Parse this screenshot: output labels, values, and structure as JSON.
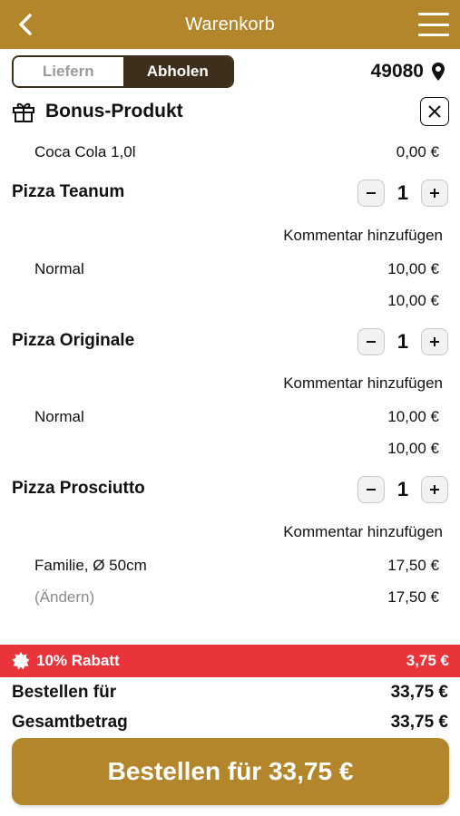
{
  "colors": {
    "accent": "#b4862c",
    "toggle_dark": "#3e2f1c",
    "discount_red": "#e8343a"
  },
  "header": {
    "title": "Warenkorb",
    "back_icon": "chevron-left-icon",
    "menu_icon": "hamburger-menu-icon"
  },
  "delivery_toggle": {
    "options": [
      "Liefern",
      "Abholen"
    ],
    "selected": "Abholen"
  },
  "location": {
    "zip": "49080",
    "icon": "map-pin-icon"
  },
  "bonus": {
    "label": "Bonus-Produkt",
    "icon": "gift-icon",
    "close_icon": "close-icon",
    "item": {
      "name": "Coca Cola 1,0l",
      "price": "0,00 €"
    }
  },
  "products": [
    {
      "name": "Pizza Teanum",
      "qty": "1",
      "comment": "Kommentar hinzufügen",
      "variant": "Normal",
      "variant_price": "10,00 €",
      "total": "10,00 €"
    },
    {
      "name": "Pizza Originale",
      "qty": "1",
      "comment": "Kommentar hinzufügen",
      "variant": "Normal",
      "variant_price": "10,00 €",
      "total": "10,00 €"
    },
    {
      "name": "Pizza Prosciutto",
      "qty": "1",
      "comment": "Kommentar hinzufügen",
      "variant": "Familie, Ø 50cm",
      "variant_price": "17,50 €",
      "change_label": "(Ändern)",
      "total": "17,50 €"
    }
  ],
  "discount": {
    "label": "10% Rabatt",
    "icon": "badge-icon",
    "value": "3,75 €"
  },
  "summary": {
    "order_for_label": "Bestellen für",
    "order_for_value": "33,75 €",
    "total_label": "Gesamtbetrag",
    "total_value": "33,75 €"
  },
  "order_button": {
    "label": "Bestellen für 33,75 €"
  }
}
